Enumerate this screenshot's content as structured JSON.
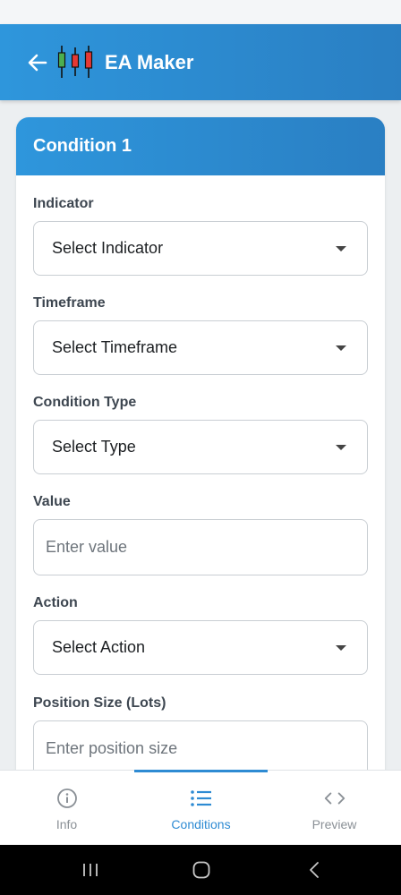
{
  "app": {
    "title": "EA Maker"
  },
  "card": {
    "title": "Condition 1"
  },
  "form": {
    "indicator": {
      "label": "Indicator",
      "value": "Select Indicator"
    },
    "timeframe": {
      "label": "Timeframe",
      "value": "Select Timeframe"
    },
    "condition_type": {
      "label": "Condition Type",
      "value": "Select Type"
    },
    "value": {
      "label": "Value",
      "placeholder": "Enter value"
    },
    "action": {
      "label": "Action",
      "value": "Select Action"
    },
    "position_size": {
      "label": "Position Size (Lots)",
      "placeholder": "Enter position size"
    }
  },
  "bottom_nav": {
    "items": [
      {
        "label": "Info",
        "icon": "info-icon",
        "active": false
      },
      {
        "label": "Conditions",
        "icon": "list-icon",
        "active": true
      },
      {
        "label": "Preview",
        "icon": "code-icon",
        "active": false
      }
    ]
  },
  "colors": {
    "primary": "#2e8bd3",
    "header_gradient_start": "#2e96dc",
    "header_gradient_end": "#2a7fc3",
    "inactive": "#8a9096"
  }
}
